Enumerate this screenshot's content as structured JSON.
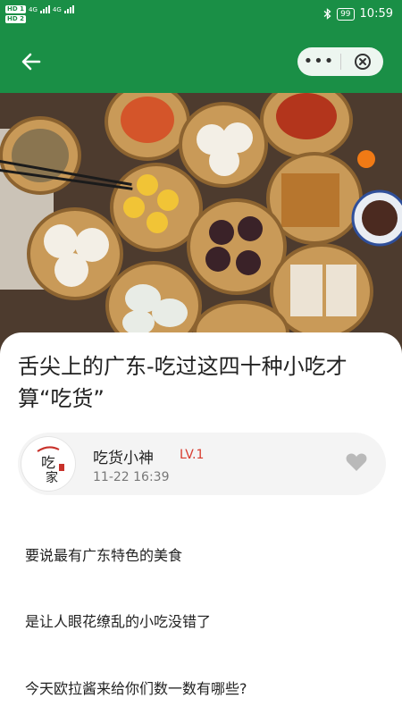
{
  "status_bar": {
    "sim1": "HD 1",
    "sim2": "HD 2",
    "network1": "4G",
    "network2": "4G",
    "battery": "99",
    "time": "10:59"
  },
  "colors": {
    "accent": "#1a8f46",
    "level": "#d83b2e"
  },
  "nav": {
    "back_icon": "back-arrow-icon",
    "more_label": "•••",
    "close_icon": "close-circle-icon"
  },
  "article": {
    "title": "舌尖上的广东-吃过这四十种小吃才算“吃货”",
    "author": {
      "name": "吃货小神",
      "level": "LV.1",
      "time": "11-22 16:39",
      "avatar_text_1": "吃",
      "avatar_text_2": "家"
    },
    "paragraphs": [
      "要说最有广东特色的美食",
      "是让人眼花缭乱的小吃没错了",
      "今天欧拉酱来给你们数一数有哪些?"
    ]
  }
}
